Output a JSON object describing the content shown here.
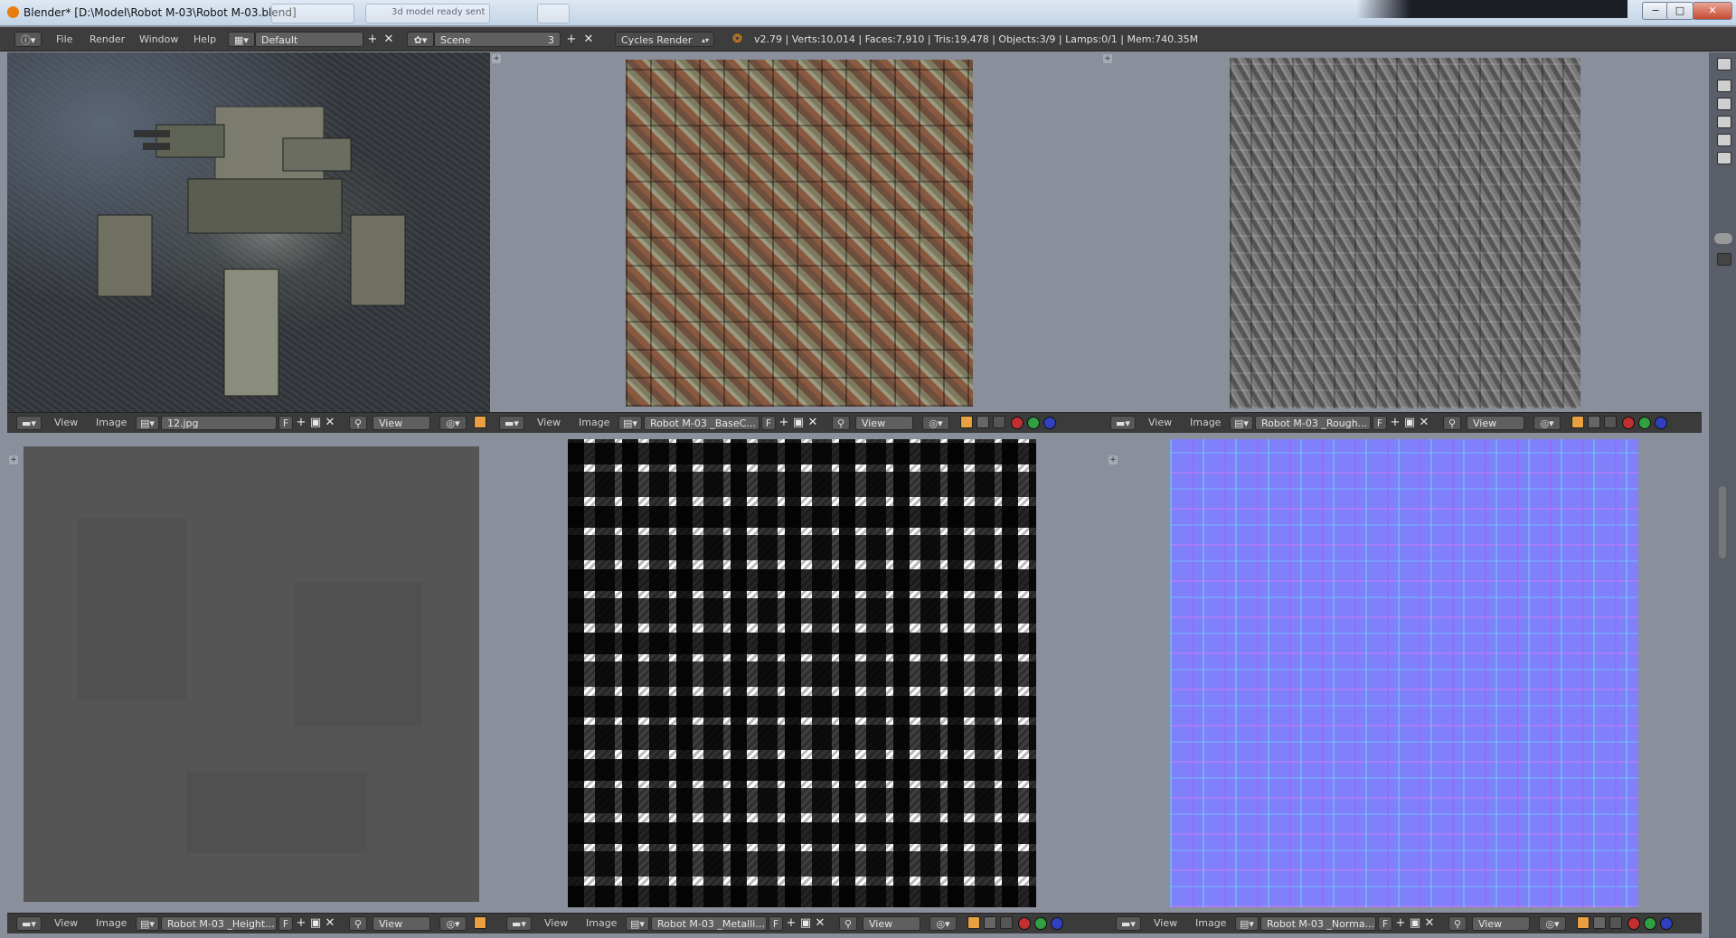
{
  "window": {
    "title": "Blender* [D:\\Model\\Robot M-03\\Robot M-03.blend]",
    "ghost_tab_2": "3d model ready sent",
    "minimize": "−",
    "maximize": "□",
    "close": "✕"
  },
  "info_header": {
    "menus": [
      "File",
      "Render",
      "Window",
      "Help"
    ],
    "screen_layout": "Default",
    "scene": "Scene",
    "scene_users": "3",
    "render_engine": "Cycles Render",
    "stats": "v2.79 | Verts:10,014 | Faces:7,910 | Tris:19,478 | Objects:3/9 | Lamps:0/1 | Mem:740.35M"
  },
  "editors": [
    {
      "view_menu": "View",
      "image_menu": "Image",
      "image_name": "12.jpg",
      "fake_user": "F",
      "display_mode": "View"
    },
    {
      "view_menu": "View",
      "image_menu": "Image",
      "image_name": "Robot M-03 _BaseC...",
      "fake_user": "F",
      "display_mode": "View"
    },
    {
      "view_menu": "View",
      "image_menu": "Image",
      "image_name": "Robot M-03 _Rough...",
      "fake_user": "F",
      "display_mode": "View"
    },
    {
      "view_menu": "View",
      "image_menu": "Image",
      "image_name": "Robot M-03 _Height...",
      "fake_user": "F",
      "display_mode": "View"
    },
    {
      "view_menu": "View",
      "image_menu": "Image",
      "image_name": "Robot M-03 _Metalli...",
      "fake_user": "F",
      "display_mode": "View"
    },
    {
      "view_menu": "View",
      "image_menu": "Image",
      "image_name": "Robot M-03 _Norma...",
      "fake_user": "F",
      "display_mode": "View"
    }
  ],
  "colors": {
    "accent_orange": "#e8a040",
    "red_channel": "#c03030",
    "green_channel": "#30a040",
    "blue_channel": "#3040c0"
  }
}
